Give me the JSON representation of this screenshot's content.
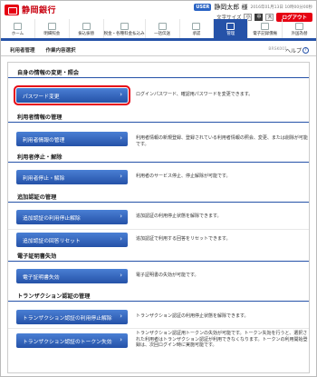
{
  "header": {
    "bank_name": "静岡銀行",
    "user_badge": "USER",
    "user_name": "静岡太郎 様",
    "last_login": "2016年01月13日 10時00分00秒",
    "size_label": "文字サイズ",
    "size_small": "小",
    "size_medium": "中",
    "size_large": "大",
    "logout_label": "ログアウト"
  },
  "nav": [
    {
      "label": "ホーム",
      "icon": "home-icon"
    },
    {
      "label": "明細照会",
      "icon": "statement-icon"
    },
    {
      "label": "振込振替",
      "icon": "transfer-icon"
    },
    {
      "label": "税金・各種料金払込み",
      "icon": "tax-icon"
    },
    {
      "label": "一括伝送",
      "icon": "bulk-icon"
    },
    {
      "label": "承認",
      "icon": "approval-icon"
    },
    {
      "label": "管理",
      "icon": "manage-icon"
    },
    {
      "label": "電子記録債権",
      "icon": "ebond-icon"
    },
    {
      "label": "外国為替",
      "icon": "fx-icon"
    }
  ],
  "subheader": {
    "crumb_a": "利用者管理",
    "crumb_b": "作業内容選択",
    "screen_id": "BRSK001",
    "help": "ヘルプ"
  },
  "sections": {
    "s1": {
      "title": "自身の情報の変更・照会"
    },
    "s2": {
      "title": "利用者情報の管理"
    },
    "s3": {
      "title": "利用者停止・解除"
    },
    "s4": {
      "title": "追加認証の管理"
    },
    "s5": {
      "title": "電子証明書失効"
    },
    "s6": {
      "title": "トランザクション認証の管理"
    }
  },
  "rows": {
    "password": {
      "label": "パスワード変更",
      "desc": "ログインパスワード、確認用パスワードを変更できます。"
    },
    "user_mgmt": {
      "label": "利用者情報の管理",
      "desc": "利用者情報の新規登録、登録されている利用者情報の照会、変更、または削除が可能です。"
    },
    "user_stop": {
      "label": "利用者停止・解除",
      "desc": "利用者のサービス停止、停止解除が可能です。"
    },
    "auth_unlock": {
      "label": "追加認証の利用停止解除",
      "desc": "追加認証の利用停止状態を解除できます。"
    },
    "auth_reset": {
      "label": "追加認証の回答リセット",
      "desc": "追加認証で利用する回答をリセットできます。"
    },
    "cert_revoke": {
      "label": "電子証明書失効",
      "desc": "電子証明書の失効が可能です。"
    },
    "tx_unlock": {
      "label": "トランザクション認証の利用停止解除",
      "desc": "トランザクション認証の利用停止状態を解除できます。"
    },
    "tx_token": {
      "label": "トランザクション認証のトークン失効",
      "desc": "トランザクション認証用トークンの失効が可能です。トークン失効を行うと、選択された利用者はトランザクション認証が利用できなくなります。トークンの利用開始登録は、次回ログイン時に実施可能です。"
    }
  }
}
